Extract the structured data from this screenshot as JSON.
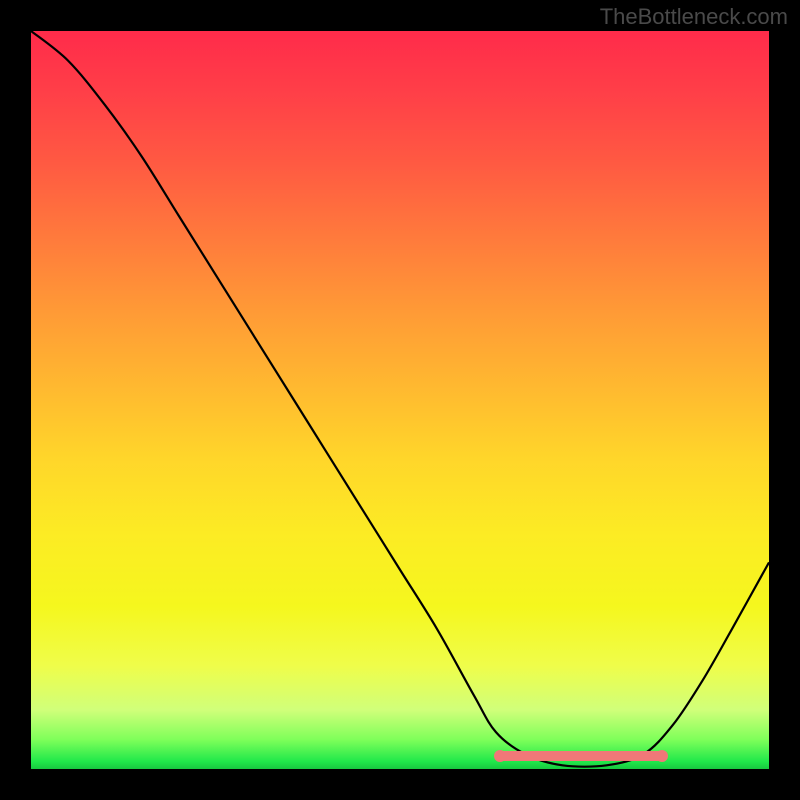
{
  "watermark": "TheBottleneck.com",
  "chart_data": {
    "type": "line",
    "title": "",
    "xlabel": "",
    "ylabel": "",
    "xlim": [
      0,
      1
    ],
    "ylim": [
      0,
      1
    ],
    "series": [
      {
        "name": "curve",
        "x": [
          0.0,
          0.05,
          0.1,
          0.15,
          0.2,
          0.25,
          0.3,
          0.35,
          0.4,
          0.45,
          0.5,
          0.55,
          0.6,
          0.63,
          0.67,
          0.72,
          0.78,
          0.83,
          0.87,
          0.91,
          0.95,
          1.0
        ],
        "values": [
          1.0,
          0.96,
          0.9,
          0.83,
          0.75,
          0.67,
          0.59,
          0.51,
          0.43,
          0.35,
          0.27,
          0.19,
          0.1,
          0.05,
          0.02,
          0.005,
          0.005,
          0.02,
          0.06,
          0.12,
          0.19,
          0.28
        ]
      }
    ],
    "highlight_band": {
      "x_start": 0.63,
      "x_end": 0.86,
      "y": 0.018
    },
    "background": "red-to-green vertical gradient",
    "colors": {
      "curve": "#000000",
      "band": "#f07878",
      "frame": "#000000"
    }
  }
}
